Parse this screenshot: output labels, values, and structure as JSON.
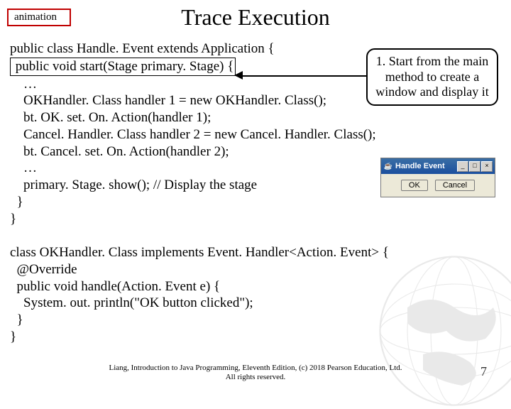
{
  "badge": "animation",
  "title": "Trace Execution",
  "callout": "1. Start from the main method to create a window and display it",
  "code": {
    "l1": "public class Handle. Event extends Application {",
    "l2_boxed": " public void start(Stage primary. Stage) {",
    "l3": "    …",
    "l4": "    OKHandler. Class handler 1 = new OKHandler. Class();",
    "l5": "    bt. OK. set. On. Action(handler 1);",
    "l6": "    Cancel. Handler. Class handler 2 = new Cancel. Handler. Class();",
    "l7": "    bt. Cancel. set. On. Action(handler 2);",
    "l8": "    …",
    "l9": "    primary. Stage. show(); // Display the stage",
    "l10": "  }",
    "l11": "}",
    "b1": "class OKHandler. Class implements Event. Handler<Action. Event> {",
    "b2": "  @Override",
    "b3": "  public void handle(Action. Event e) {",
    "b4": "    System. out. println(\"OK button clicked\");",
    "b5": "  }",
    "b6": "}"
  },
  "app": {
    "title": "Handle Event",
    "ok": "OK",
    "cancel": "Cancel",
    "min": "_",
    "max": "□",
    "close": "×"
  },
  "footer": {
    "l1": "Liang, Introduction to Java Programming, Eleventh Edition, (c) 2018 Pearson Education, Ltd.",
    "l2": "All rights reserved."
  },
  "page": "7"
}
